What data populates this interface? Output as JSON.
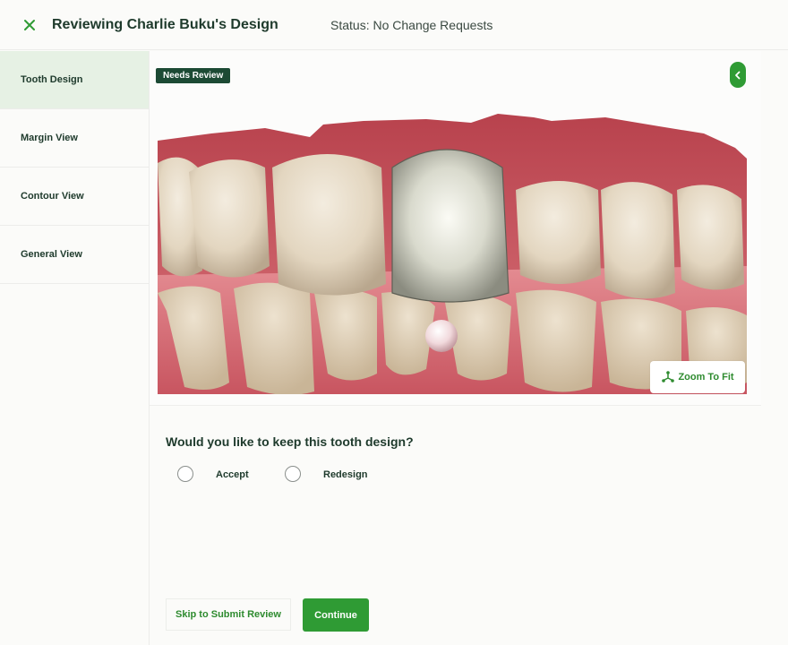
{
  "header": {
    "close_icon": "close-icon",
    "title": "Reviewing Charlie Buku's Design",
    "status": "Status: No Change Requests"
  },
  "sidebar": {
    "items": [
      {
        "label": "Tooth Design",
        "active": true
      },
      {
        "label": "Margin View",
        "active": false
      },
      {
        "label": "Contour View",
        "active": false
      },
      {
        "label": "General View",
        "active": false
      }
    ]
  },
  "viewer": {
    "badge": "Needs Review",
    "collapse_icon": "chevron-left-icon",
    "zoom_icon": "zoom-fit-icon",
    "zoom_label": "Zoom To Fit"
  },
  "question": {
    "text": "Would you like to keep this tooth design?",
    "options": [
      "Accept",
      "Redesign"
    ]
  },
  "actions": {
    "skip_label": "Skip to Submit Review",
    "continue_label": "Continue"
  },
  "colors": {
    "accent": "#2f9b34",
    "badge": "#1c4a34",
    "active_tab": "#e6f1e4",
    "text_dark": "#1e3a2c"
  }
}
